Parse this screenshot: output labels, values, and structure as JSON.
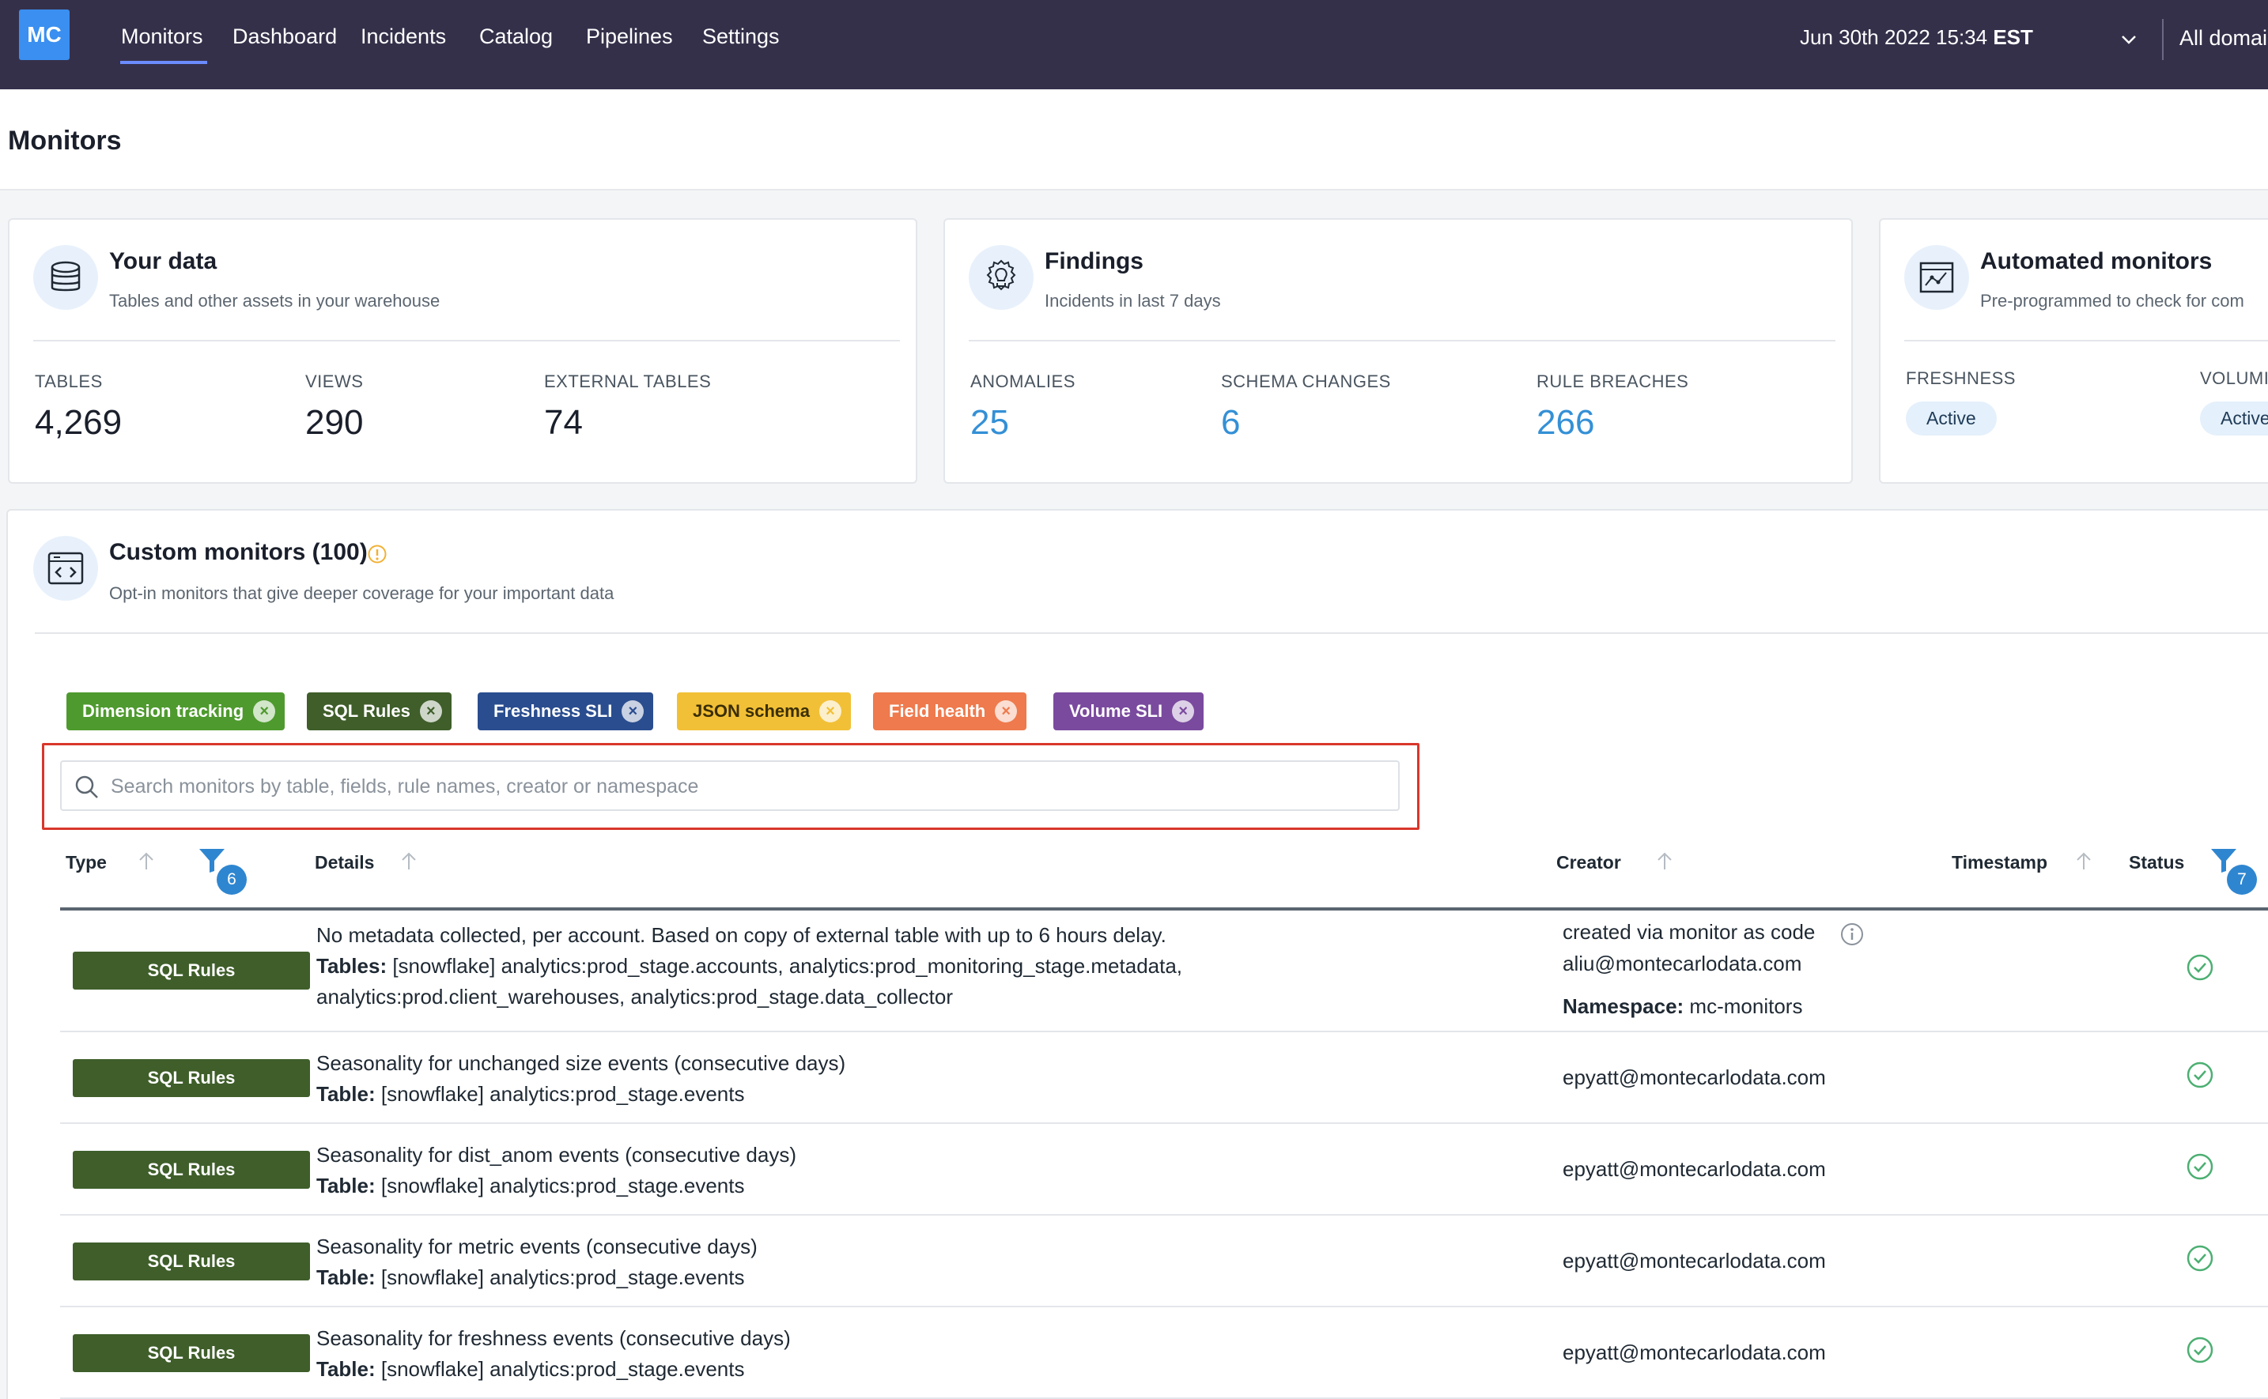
{
  "nav": {
    "logo": "MC",
    "items": [
      "Monitors",
      "Dashboard",
      "Incidents",
      "Catalog",
      "Pipelines",
      "Settings"
    ],
    "date": "Jun 30th 2022 15:34",
    "timezone": "EST",
    "domain": "All domai"
  },
  "page": {
    "title": "Monitors"
  },
  "cards": {
    "your_data": {
      "title": "Your data",
      "subtitle": "Tables and other assets in your warehouse",
      "stats": [
        {
          "label": "TABLES",
          "value": "4,269"
        },
        {
          "label": "VIEWS",
          "value": "290"
        },
        {
          "label": "EXTERNAL TABLES",
          "value": "74"
        }
      ]
    },
    "findings": {
      "title": "Findings",
      "subtitle": "Incidents in last 7 days",
      "stats": [
        {
          "label": "ANOMALIES",
          "value": "25"
        },
        {
          "label": "SCHEMA CHANGES",
          "value": "6"
        },
        {
          "label": "RULE BREACHES",
          "value": "266"
        }
      ]
    },
    "automated": {
      "title": "Automated monitors",
      "subtitle": "Pre-programmed to check for com",
      "stats": [
        {
          "label": "FRESHNESS",
          "value": "Active"
        },
        {
          "label": "VOLUMI",
          "value": "Active"
        }
      ]
    }
  },
  "custom": {
    "title": "Custom monitors (100)",
    "subtitle": "Opt-in monitors that give deeper coverage for your important data",
    "chips": [
      {
        "label": "Dimension tracking",
        "color": "#4e9a2e",
        "text": "#ffffff"
      },
      {
        "label": "SQL Rules",
        "color": "#3f5e2a",
        "text": "#ffffff"
      },
      {
        "label": "Freshness SLI",
        "color": "#2a4d8f",
        "text": "#ffffff"
      },
      {
        "label": "JSON schema",
        "color": "#f2c037",
        "text": "#3a2e05"
      },
      {
        "label": "Field health",
        "color": "#ee7a4d",
        "text": "#ffffff"
      },
      {
        "label": "Volume SLI",
        "color": "#7a4a9e",
        "text": "#ffffff"
      }
    ],
    "search_placeholder": "Search monitors by table, fields, rule names, creator or namespace",
    "columns": {
      "type": "Type",
      "type_filter_count": "6",
      "details": "Details",
      "creator": "Creator",
      "timestamp": "Timestamp",
      "status": "Status",
      "status_filter_count": "7"
    },
    "rows": [
      {
        "type": "SQL Rules",
        "line1": "No metadata collected, per account. Based on copy of external table with up to 6 hours delay.",
        "label2": "Tables:",
        "line2": " [snowflake] analytics:prod_stage.accounts, analytics:prod_monitoring_stage.metadata,",
        "line3": "analytics:prod.client_warehouses, analytics:prod_stage.data_collector",
        "creator_note": "created via monitor as code",
        "creator": "aliu@montecarlodata.com",
        "namespace_label": "Namespace:",
        "namespace": " mc-monitors"
      },
      {
        "type": "SQL Rules",
        "line1": "Seasonality for unchanged size events (consecutive days)",
        "label2": "Table:",
        "line2": " [snowflake] analytics:prod_stage.events",
        "creator": "epyatt@montecarlodata.com"
      },
      {
        "type": "SQL Rules",
        "line1": "Seasonality for dist_anom events (consecutive days)",
        "label2": "Table:",
        "line2": " [snowflake] analytics:prod_stage.events",
        "creator": "epyatt@montecarlodata.com"
      },
      {
        "type": "SQL Rules",
        "line1": "Seasonality for metric events (consecutive days)",
        "label2": "Table:",
        "line2": " [snowflake] analytics:prod_stage.events",
        "creator": "epyatt@montecarlodata.com"
      },
      {
        "type": "SQL Rules",
        "line1": "Seasonality for freshness events (consecutive days)",
        "label2": "Table:",
        "line2": " [snowflake] analytics:prod_stage.events",
        "creator": "epyatt@montecarlodata.com"
      }
    ]
  }
}
